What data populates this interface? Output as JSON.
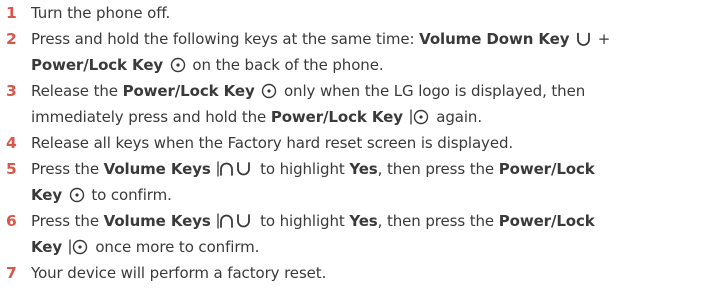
{
  "colors": {
    "step_number": "#d9574a",
    "text": "#3a3a3a",
    "icon_stroke": "#3a3a3a"
  },
  "steps": [
    {
      "number": "1",
      "lines": [
        [
          {
            "t": "Turn the phone off."
          }
        ]
      ]
    },
    {
      "number": "2",
      "lines": [
        [
          {
            "t": "Press and hold the following keys at the same time: "
          },
          {
            "t": "Volume Down Key",
            "b": true
          },
          {
            "t": " "
          },
          {
            "icon": "volume-down-key-icon"
          },
          {
            "t": " +"
          }
        ],
        [
          {
            "t": "Power/Lock Key",
            "b": true
          },
          {
            "t": " "
          },
          {
            "icon": "power-lock-key-icon"
          },
          {
            "t": " on the back of the phone."
          }
        ]
      ]
    },
    {
      "number": "3",
      "lines": [
        [
          {
            "t": "Release the "
          },
          {
            "t": "Power/Lock Key",
            "b": true
          },
          {
            "t": " "
          },
          {
            "icon": "power-lock-key-icon"
          },
          {
            "t": " only when the LG logo is displayed, then"
          }
        ],
        [
          {
            "t": "immediately press and hold the "
          },
          {
            "t": "Power/Lock Key",
            "b": true
          },
          {
            "t": " "
          },
          {
            "icon": "power-lock-key-bar-icon"
          },
          {
            "t": " again."
          }
        ]
      ]
    },
    {
      "number": "4",
      "lines": [
        [
          {
            "t": "Release all keys when the Factory hard reset screen is displayed."
          }
        ]
      ]
    },
    {
      "number": "5",
      "lines": [
        [
          {
            "t": "Press the "
          },
          {
            "t": "Volume Keys",
            "b": true
          },
          {
            "t": " "
          },
          {
            "icon": "volume-keys-icon"
          },
          {
            "t": " to highlight "
          },
          {
            "t": "Yes",
            "b": true
          },
          {
            "t": ", then press the "
          },
          {
            "t": "Power/Lock",
            "b": true
          }
        ],
        [
          {
            "t": "Key",
            "b": true
          },
          {
            "t": " "
          },
          {
            "icon": "power-lock-key-icon"
          },
          {
            "t": " to confirm."
          }
        ]
      ]
    },
    {
      "number": "6",
      "lines": [
        [
          {
            "t": "Press the "
          },
          {
            "t": "Volume Keys",
            "b": true
          },
          {
            "t": " "
          },
          {
            "icon": "volume-keys-icon"
          },
          {
            "t": " to highlight "
          },
          {
            "t": "Yes",
            "b": true
          },
          {
            "t": ", then press the "
          },
          {
            "t": "Power/Lock",
            "b": true
          }
        ],
        [
          {
            "t": "Key",
            "b": true
          },
          {
            "t": " "
          },
          {
            "icon": "power-lock-key-bar-icon"
          },
          {
            "t": " once more to confirm."
          }
        ]
      ]
    },
    {
      "number": "7",
      "lines": [
        [
          {
            "t": "Your device will perform a factory reset."
          }
        ]
      ]
    }
  ]
}
